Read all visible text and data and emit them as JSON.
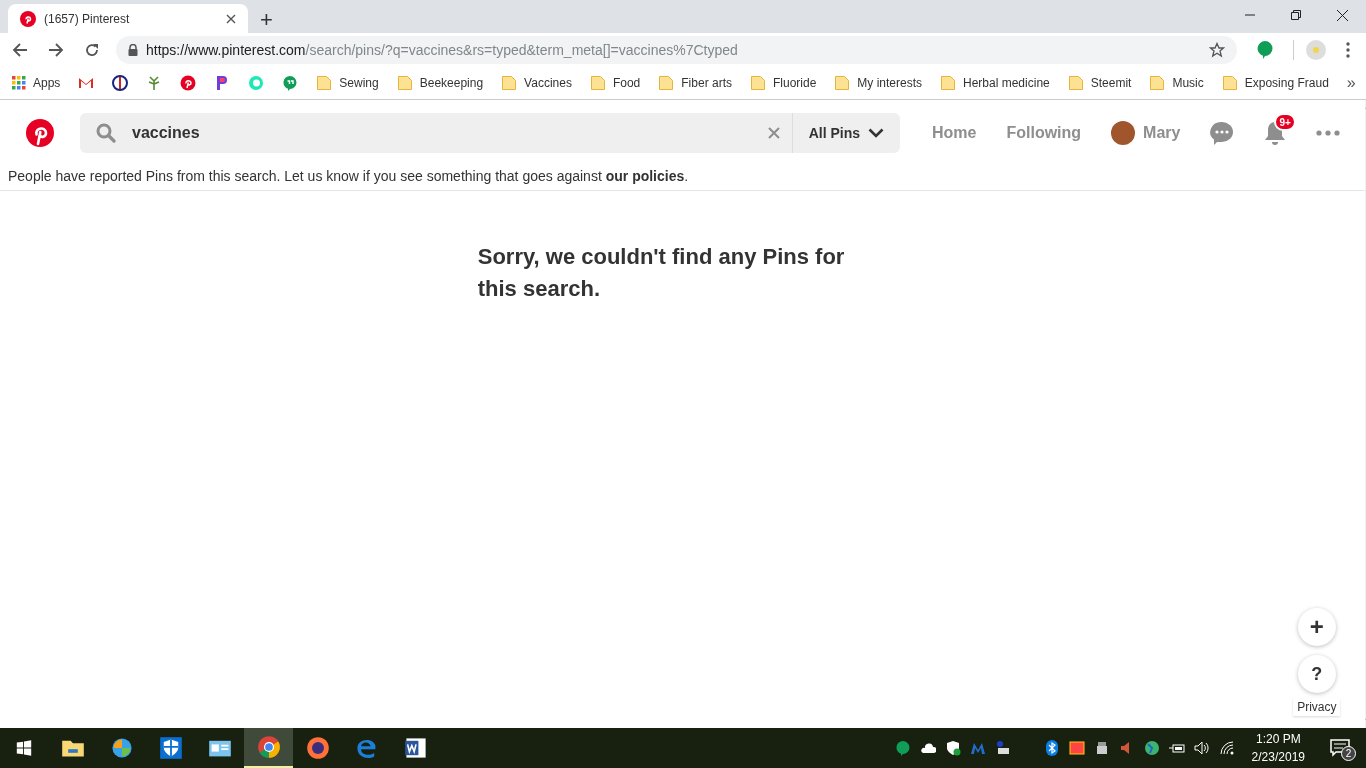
{
  "browser": {
    "tab_title": "(1657) Pinterest",
    "new_tab": "+",
    "url_host": "https://www.pinterest.com",
    "url_path": "/search/pins/?q=vaccines&rs=typed&term_meta[]=vaccines%7Ctyped",
    "bookmarks": [
      {
        "kind": "apps",
        "label": "Apps"
      },
      {
        "kind": "folder",
        "label": "Sewing"
      },
      {
        "kind": "folder",
        "label": "Beekeeping"
      },
      {
        "kind": "folder",
        "label": "Vaccines"
      },
      {
        "kind": "folder",
        "label": "Food"
      },
      {
        "kind": "folder",
        "label": "Fiber arts"
      },
      {
        "kind": "folder",
        "label": "Fluoride"
      },
      {
        "kind": "folder",
        "label": "My interests"
      },
      {
        "kind": "folder",
        "label": "Herbal medicine"
      },
      {
        "kind": "folder",
        "label": "Steemit"
      },
      {
        "kind": "folder",
        "label": "Music"
      },
      {
        "kind": "folder",
        "label": "Exposing Fraud"
      }
    ],
    "more": "»"
  },
  "header": {
    "search_value": "vaccines",
    "filter": "All Pins",
    "nav": [
      {
        "label": "Home"
      },
      {
        "label": "Following"
      }
    ],
    "user": "Mary",
    "badge": "9+"
  },
  "notice": {
    "text": "People have reported Pins from this search. Let us know if you see something that goes against",
    "link": "our policies",
    "after": "."
  },
  "empty_message": "Sorry, we couldn't find any Pins for this search.",
  "floating": {
    "add": "+",
    "help": "?",
    "privacy": "Privacy"
  },
  "taskbar": {
    "apps": [
      {
        "selected": false
      },
      {
        "selected": false
      },
      {
        "selected": false
      },
      {
        "selected": false
      },
      {
        "selected": true
      },
      {
        "selected": false
      },
      {
        "selected": false
      },
      {
        "selected": false
      }
    ],
    "time": "1:20 PM",
    "date": "2/23/2019",
    "notifications": "2"
  }
}
